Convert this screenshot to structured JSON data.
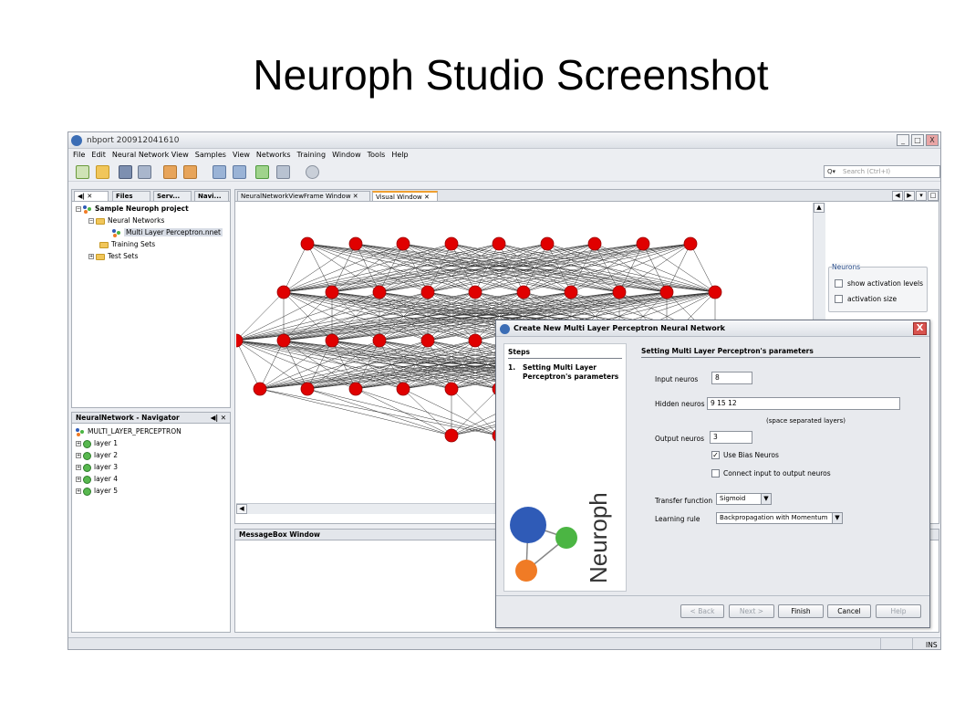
{
  "slide": {
    "title": "Neuroph Studio Screenshot"
  },
  "window": {
    "title": "nbport 200912041610",
    "min_label": "_",
    "max_label": "□",
    "close_label": "X"
  },
  "menu": [
    "File",
    "Edit",
    "Neural Network View",
    "Samples",
    "View",
    "Networks",
    "Training",
    "Window",
    "Tools",
    "Help"
  ],
  "search": {
    "placeholder": "Search (Ctrl+I)",
    "icon": "Q▾"
  },
  "projects_panel": {
    "tabs": [
      "◀| ✕",
      "Files",
      "Serv...",
      "Navi..."
    ],
    "tree": {
      "project": "Sample Neuroph project",
      "neural_networks": "Neural Networks",
      "network_file": "Multi Layer Perceptron.nnet",
      "training_sets": "Training Sets",
      "test_sets": "Test Sets"
    }
  },
  "editor_tabs": [
    "NeuralNetworkViewFrame Window",
    "Visual Window"
  ],
  "neurons_panel": {
    "group": "Neurons",
    "show_activation_levels": "show activation levels",
    "activation_size": "activation size"
  },
  "navigator": {
    "title": "NeuralNetwork - Navigator",
    "controls": "◀| ✕",
    "root": "MULTI_LAYER_PERCEPTRON",
    "layers": [
      "layer 1",
      "layer 2",
      "layer 3",
      "layer 4",
      "layer 5"
    ]
  },
  "messagebox": {
    "title": "MessageBox Window"
  },
  "dialog": {
    "title": "Create New Multi Layer Perceptron Neural Network",
    "close_label": "X",
    "steps_header": "Steps",
    "step_number": "1.",
    "step_text_1": "Setting Multi Layer",
    "step_text_2": "Perceptron's parameters",
    "logo_text": "Neuroph",
    "section_title": "Setting Multi Layer Perceptron's parameters",
    "input_label": "Input neuros",
    "input_value": "8",
    "hidden_label": "Hidden neuros",
    "hidden_value": "9 15 12",
    "hidden_hint": "(space separated layers)",
    "output_label": "Output neuros",
    "output_value": "3",
    "use_bias_label": "Use Bias Neuros",
    "use_bias_checked": "✓",
    "connect_label": "Connect input to output neuros",
    "transfer_label": "Transfer function",
    "transfer_value": "Sigmoid",
    "learning_label": "Learning rule",
    "learning_value": "Backpropagation with Momentum",
    "buttons": {
      "back": "< Back",
      "next": "Next >",
      "finish": "Finish",
      "cancel": "Cancel",
      "help": "Help"
    }
  },
  "status": {
    "mode": "INS"
  },
  "colors": {
    "neuron": "#e00000",
    "accent": "#3b6db5",
    "logo_blue": "#2f5bb7",
    "logo_green": "#4bb543",
    "logo_orange": "#f07b25"
  }
}
